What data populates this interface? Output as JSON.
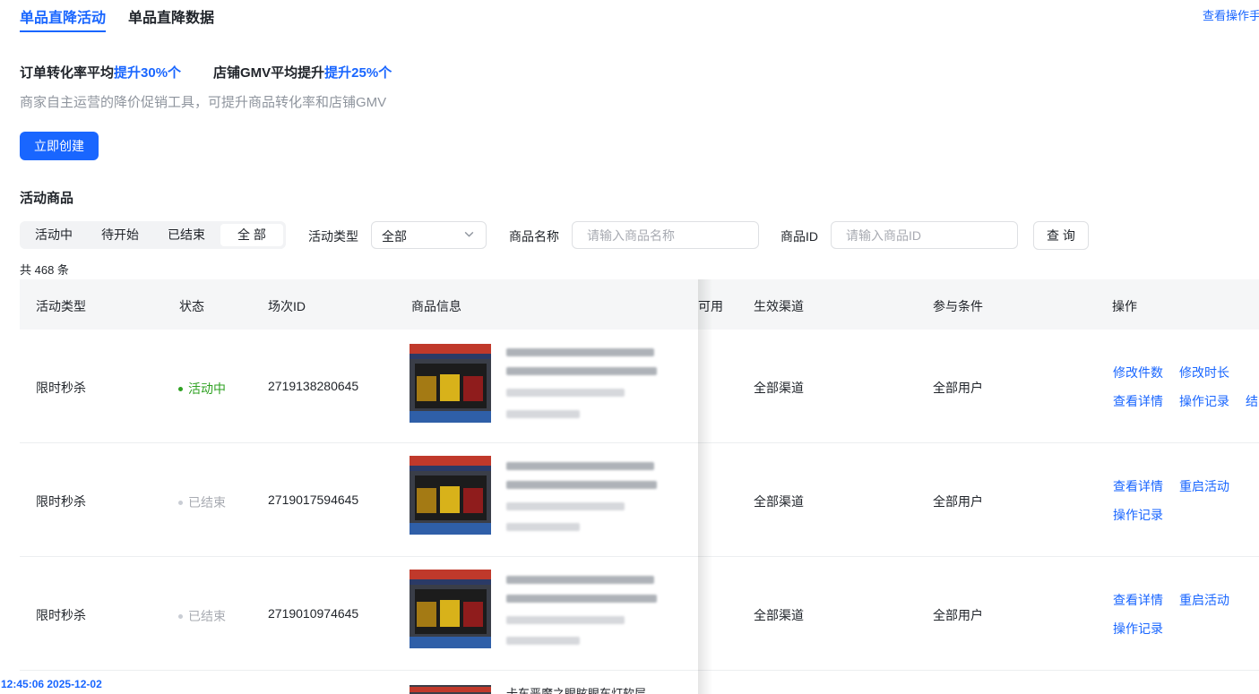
{
  "tabs": [
    {
      "label": "单品直降活动",
      "active": true
    },
    {
      "label": "单品直降数据",
      "active": false
    }
  ],
  "help_link": "查看操作手",
  "promo": {
    "item1_prefix": "订单转化率平均",
    "item1_highlight": "提升30%个",
    "item2_prefix": "店铺GMV平均提升",
    "item2_highlight": "提升25%个"
  },
  "description": "商家自主运营的降价促销工具，可提升商品转化率和店铺GMV",
  "create_button": "立即创建",
  "section_title": "活动商品",
  "filters": {
    "status_tabs": [
      "活动中",
      "待开始",
      "已结束",
      "全 部"
    ],
    "status_active_index": 3,
    "type_label": "活动类型",
    "type_value": "全部",
    "name_label": "商品名称",
    "name_placeholder": "请输入商品名称",
    "id_label": "商品ID",
    "id_placeholder": "请输入商品ID",
    "query_button": "查 询"
  },
  "total_text": "共 468 条",
  "table": {
    "columns": [
      "活动类型",
      "状态",
      "场次ID",
      "商品信息",
      "可用",
      "生效渠道",
      "参与条件",
      "操作"
    ],
    "rows": [
      {
        "type": "限时秒杀",
        "status": "活动中",
        "status_kind": "active",
        "session_id": "2719138280645",
        "channel": "全部渠道",
        "condition": "全部用户",
        "actions": [
          "修改件数",
          "修改时长",
          "查看详情",
          "操作记录",
          "结"
        ]
      },
      {
        "type": "限时秒杀",
        "status": "已结束",
        "status_kind": "ended",
        "session_id": "2719017594645",
        "channel": "全部渠道",
        "condition": "全部用户",
        "actions": [
          "查看详情",
          "重启活动",
          "操作记录"
        ]
      },
      {
        "type": "限时秒杀",
        "status": "已结束",
        "status_kind": "ended",
        "session_id": "2719010974645",
        "channel": "全部渠道",
        "condition": "全部用户",
        "actions": [
          "查看详情",
          "重启活动",
          "操作记录"
        ]
      }
    ],
    "partial_row_text": "卡车恶魔之眼眩眼车灯软层"
  },
  "timestamp": "12:45:06 2025-12-02",
  "colors": {
    "accent": "#1966ff",
    "active_status": "#2ea121",
    "ended_status": "#a8abb2",
    "header_bg": "#f5f6f7"
  }
}
